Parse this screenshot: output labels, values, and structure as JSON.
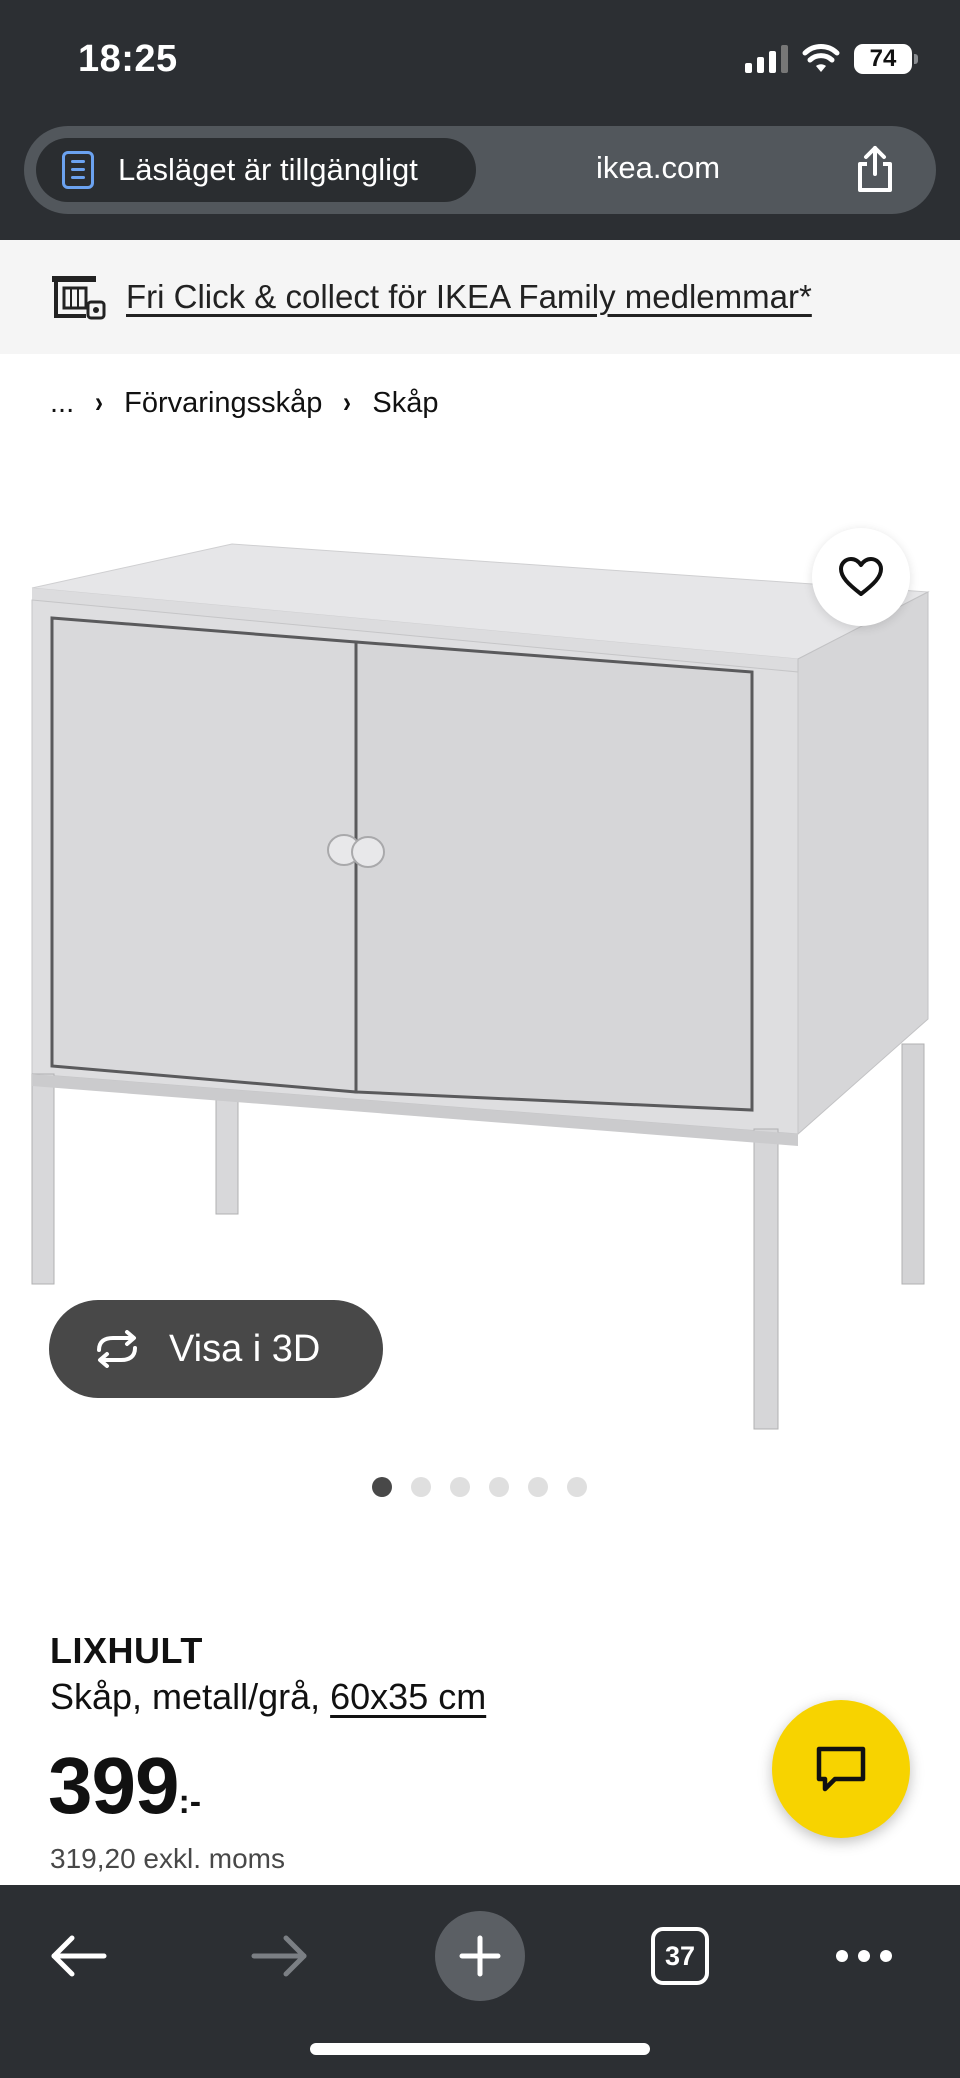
{
  "status_bar": {
    "time": "18:25",
    "battery": "74",
    "icons": [
      "cellular-signal-icon",
      "wifi-icon",
      "battery-icon"
    ]
  },
  "browser": {
    "reader_mode_label": "Läsläget är tillgängligt",
    "domain": "ikea.com",
    "tab_count": "37",
    "icons": [
      "reader-icon",
      "share-icon",
      "back-icon",
      "forward-icon",
      "plus-icon",
      "tabs-icon",
      "more-icon"
    ]
  },
  "promo": {
    "text": "Fri Click & collect för IKEA Family medlemmar*"
  },
  "breadcrumb": {
    "items": [
      "...",
      "Förvaringsskåp",
      "Skåp"
    ]
  },
  "gallery": {
    "view_3d_label": "Visa i 3D",
    "image_count": 6,
    "active_index": 0
  },
  "product": {
    "name": "LIXHULT",
    "description": "Skåp, metall/grå, ",
    "size_link": "60x35 cm",
    "price_integer": "399",
    "price_suffix": ":-",
    "price_excl_vat": "319,20 exkl. moms"
  },
  "colors": {
    "chrome_dark": "#2c2f33",
    "chat_button": "#f7d300",
    "reader_icon_blue": "#6ba2f0",
    "dot_active": "#484848",
    "dot_inactive": "#dfdfdf"
  }
}
